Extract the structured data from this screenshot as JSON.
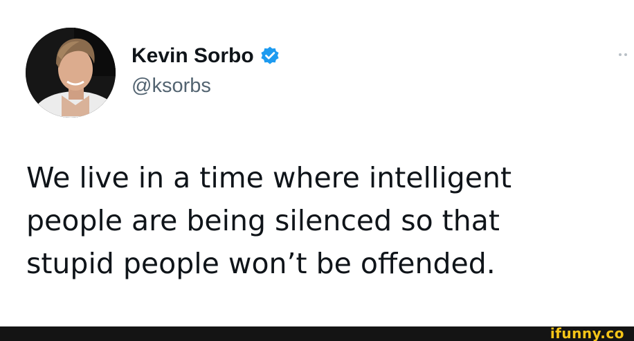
{
  "tweet": {
    "author": {
      "display_name": "Kevin Sorbo",
      "handle": "@ksorbs",
      "verified": true,
      "avatar_icon": "profile-photo"
    },
    "more_icon": "more-options-icon",
    "text_lines": [
      "We live in a time where intelligent",
      "people are being silenced so that",
      "stupid people won’t be offended."
    ]
  },
  "footer": {
    "watermark": "ifunny.co"
  },
  "colors": {
    "verified_badge": "#1d9bf0",
    "handle": "#536471",
    "text": "#0f1419",
    "footer_bar": "#141414",
    "watermark": "#f5c518"
  }
}
